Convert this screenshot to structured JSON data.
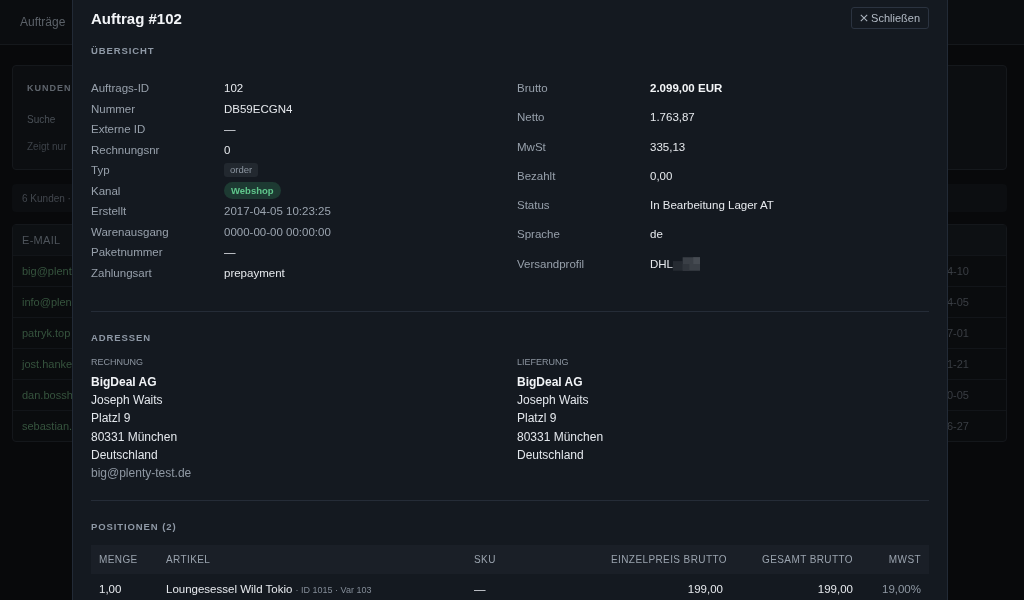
{
  "background": {
    "nav": {
      "label": "Aufträge"
    },
    "filter_card": {
      "title": "KUNDEN",
      "search_label": "Suche",
      "hint": "Zeigt nur"
    },
    "summary": "6 Kunden ·",
    "table": {
      "columns": [
        "E-MAIL"
      ],
      "rows": [
        {
          "email": "big@plent",
          "column_2": "4-10"
        },
        {
          "email": "info@plen",
          "column_2": "4-05"
        },
        {
          "email": "patryk.top",
          "column_2": "7-01"
        },
        {
          "email": "jost.hanke",
          "column_2": "1-21"
        },
        {
          "email": "dan.bossh",
          "column_2": "0-05"
        },
        {
          "email": "sebastian.",
          "column_2": "6-27"
        }
      ]
    }
  },
  "modal": {
    "title": "Auftrag #102",
    "close_button": "Schließen",
    "overview": {
      "heading": "ÜBERSICHT",
      "left": [
        {
          "label": "Auftrags-ID",
          "value": "102",
          "kind": "text"
        },
        {
          "label": "Nummer",
          "value": "DB59ECGN4",
          "kind": "text"
        },
        {
          "label": "Externe ID",
          "value": "—",
          "kind": "text"
        },
        {
          "label": "Rechnungsnr",
          "value": "0",
          "kind": "text"
        },
        {
          "label": "Typ",
          "value": "order",
          "kind": "tag"
        },
        {
          "label": "Kanal",
          "value": "Webshop",
          "kind": "pill"
        },
        {
          "label": "Erstellt",
          "value": "2017-04-05 10:23:25",
          "kind": "muted"
        },
        {
          "label": "Warenausgang",
          "value": "0000-00-00 00:00:00",
          "kind": "muted"
        },
        {
          "label": "Paketnummer",
          "value": "—",
          "kind": "text"
        },
        {
          "label": "Zahlungsart",
          "value": "prepayment",
          "kind": "text"
        }
      ],
      "right": [
        {
          "label": "Brutto",
          "value": "2.099,00 EUR",
          "kind": "strong"
        },
        {
          "label": "Netto",
          "value": "1.763,87",
          "kind": "text"
        },
        {
          "label": "MwSt",
          "value": "335,13",
          "kind": "text"
        },
        {
          "label": "Bezahlt",
          "value": "0,00",
          "kind": "text"
        },
        {
          "label": "Status",
          "value": "In Bearbeitung Lager AT",
          "kind": "text"
        },
        {
          "label": "Sprache",
          "value": "de",
          "kind": "text"
        },
        {
          "label": "Versandprofil",
          "value": "DHL",
          "kind": "redacted"
        }
      ]
    },
    "addresses": {
      "heading": "ADRESSEN",
      "blocks": [
        {
          "label": "RECHNUNG",
          "company": "BigDeal AG",
          "lines": [
            "Joseph Waits",
            "Platzl 9",
            "80331 München",
            "Deutschland"
          ],
          "email": "big@plenty-test.de"
        },
        {
          "label": "LIEFERUNG",
          "company": "BigDeal AG",
          "lines": [
            "Joseph Waits",
            "Platzl 9",
            "80331 München",
            "Deutschland"
          ]
        }
      ]
    },
    "positions": {
      "heading": "POSITIONEN (2)",
      "columns": [
        "MENGE",
        "ARTIKEL",
        "SKU",
        "EINZELPREIS BRUTTO",
        "GESAMT BRUTTO",
        "MWST"
      ],
      "rows": [
        {
          "quantity": "1,00",
          "article": "Loungesessel Wild Tokio",
          "article_meta": "· ID 1015 · Var 103",
          "sku": "—",
          "unit_price": "199,00",
          "total": "199,00",
          "vat": "19,00%"
        }
      ]
    }
  }
}
